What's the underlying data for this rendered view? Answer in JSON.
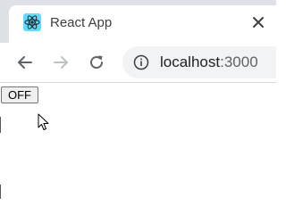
{
  "browser": {
    "tab": {
      "title": "React App",
      "icon": "react-logo-icon",
      "close_icon": "close-icon"
    },
    "toolbar": {
      "back_icon": "back-arrow-icon",
      "forward_icon": "forward-arrow-icon",
      "reload_icon": "reload-icon",
      "url": {
        "info_icon": "info-icon",
        "host": "localhost",
        "port": ":3000"
      }
    },
    "colors": {
      "tab_strip": "#dee1e6",
      "omnibox": "#f1f3f4",
      "react_blue": "#61dafb",
      "icon_gray": "#5f6368"
    }
  },
  "page": {
    "toggle_button": {
      "label": "OFF"
    },
    "cursor_icon": "mouse-pointer-icon"
  }
}
